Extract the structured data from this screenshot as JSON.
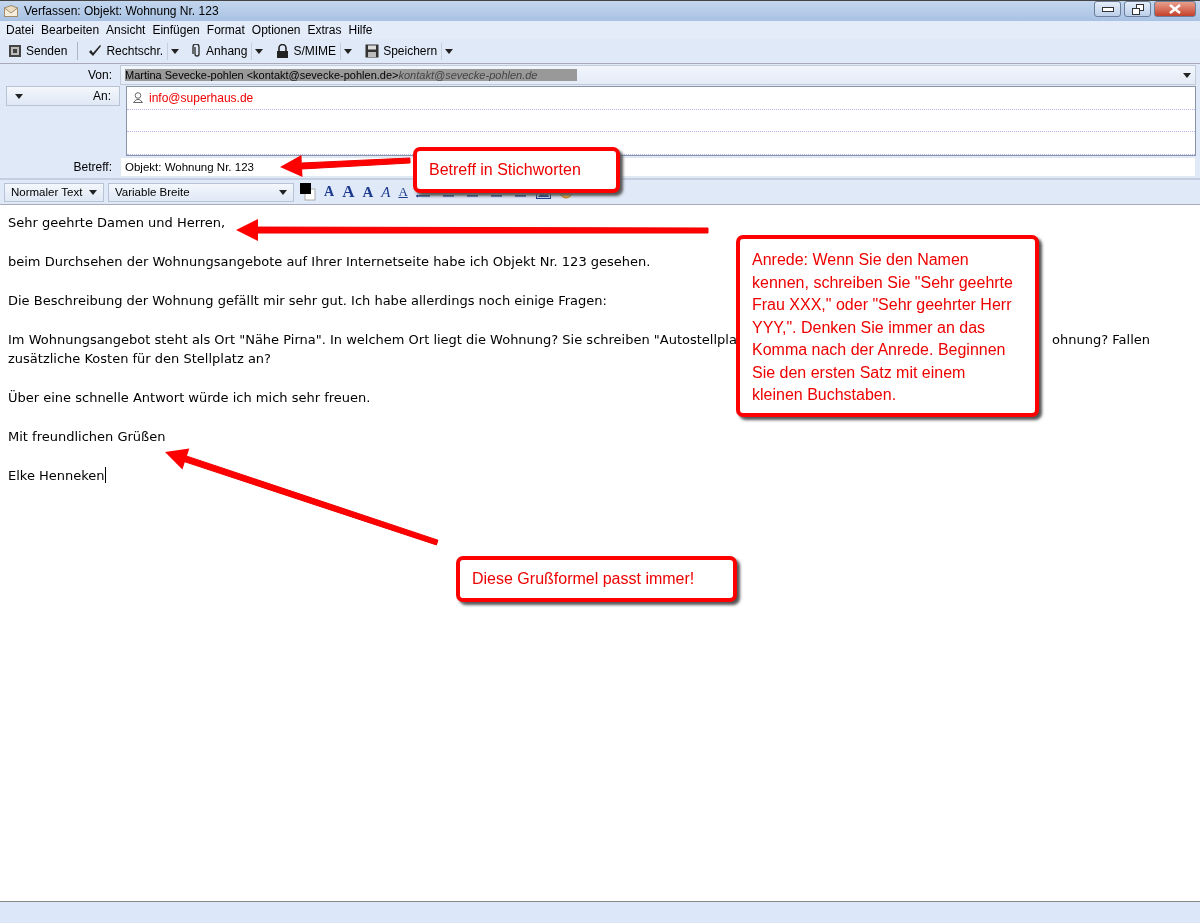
{
  "window": {
    "title": "Verfassen: Objekt: Wohnung Nr. 123"
  },
  "menu": [
    "Datei",
    "Bearbeiten",
    "Ansicht",
    "Einfügen",
    "Format",
    "Optionen",
    "Extras",
    "Hilfe"
  ],
  "toolbar": [
    {
      "label": "Senden",
      "kind": "send",
      "dropdown": false
    },
    {
      "label": "Rechtschr.",
      "kind": "check",
      "dropdown": true
    },
    {
      "label": "Anhang",
      "kind": "clip",
      "dropdown": true
    },
    {
      "label": "S/MIME",
      "kind": "lock",
      "dropdown": true
    },
    {
      "label": "Speichern",
      "kind": "save",
      "dropdown": true
    }
  ],
  "from": {
    "label": "Von:",
    "value": "Martina Sevecke-pohlen <kontakt@sevecke-pohlen.de>",
    "hint": "kontakt@sevecke-pohlen.de"
  },
  "recipient": {
    "label": "An:",
    "address": "info@superhaus.de"
  },
  "subject": {
    "label": "Betreff:",
    "value": "Objekt: Wohnung Nr. 123"
  },
  "format_bar": {
    "paragraph_style": "Normaler Text",
    "font": "Variable Breite",
    "tools": [
      {
        "kind": "color"
      },
      {
        "kind": "smaller",
        "glyph": "A"
      },
      {
        "kind": "larger",
        "glyph": "A"
      },
      {
        "kind": "bold",
        "glyph": "A"
      },
      {
        "kind": "italic",
        "glyph": "A"
      },
      {
        "kind": "underline",
        "glyph": "A"
      },
      {
        "kind": "bullets"
      },
      {
        "kind": "numbers"
      },
      {
        "kind": "outdent"
      },
      {
        "kind": "indent"
      },
      {
        "kind": "align"
      },
      {
        "kind": "image"
      },
      {
        "kind": "smiley"
      }
    ]
  },
  "body": [
    {
      "kind": "line",
      "text": "Sehr geehrte Damen und Herren,"
    },
    {
      "kind": "line",
      "text": "beim Durchsehen der Wohnungsangebote auf Ihrer Internetseite habe ich Objekt Nr. 123 gesehen."
    },
    {
      "kind": "line",
      "text": "Die Beschreibung der Wohnung gefällt mir sehr gut. Ich habe allerdings noch einige Fragen:"
    },
    {
      "kind": "split",
      "start": "Im Wohnungsangebot steht als Ort \"Nähe Pirna\". In welchem Ort liegt die Wohnung? Sie schreiben \"Autostellpla",
      "end": "ohnung? Fallen",
      "next": "zusätzliche Kosten für den Stellplatz an?"
    },
    {
      "kind": "line",
      "text": "Über eine schnelle Antwort würde ich mich sehr freuen."
    },
    {
      "kind": "line",
      "text": "Mit freundlichen Grüßen"
    },
    {
      "kind": "line",
      "text": "Elke Henneken",
      "cursor": true
    }
  ],
  "callouts": [
    "Betreff in Stichworten",
    "Anrede: Wenn Sie den Namen kennen, schreiben Sie \"Sehr geehrte Frau XXX,\" oder \"Sehr geehrter Herr YYY,\". Denken Sie immer an das Komma nach der Anrede. Beginnen Sie den ersten Satz mit einem kleinen Buchstaben.",
    "Diese Grußformel passt immer!"
  ]
}
